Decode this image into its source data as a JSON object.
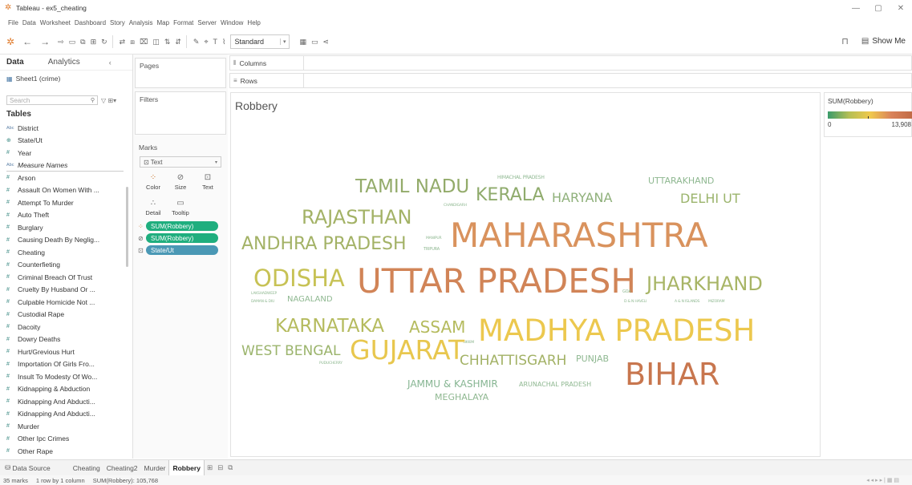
{
  "app": {
    "title": "Tableau - ex5_cheating"
  },
  "menu": [
    "File",
    "Data",
    "Worksheet",
    "Dashboard",
    "Story",
    "Analysis",
    "Map",
    "Format",
    "Server",
    "Window",
    "Help"
  ],
  "toolbar": {
    "fit_select": "Standard",
    "show_me": "Show Me"
  },
  "data_pane": {
    "tab_data": "Data",
    "tab_analytics": "Analytics",
    "source": "Sheet1 (crime)",
    "search_placeholder": "Search",
    "tables_heading": "Tables",
    "fields": [
      {
        "type": "abc",
        "name": "District"
      },
      {
        "type": "geo",
        "name": "State/Ut"
      },
      {
        "type": "num",
        "name": "Year"
      },
      {
        "type": "abc",
        "name": "Measure Names"
      },
      {
        "type": "num",
        "name": "Arson"
      },
      {
        "type": "num",
        "name": "Assault On Women With ..."
      },
      {
        "type": "num",
        "name": "Attempt To Murder"
      },
      {
        "type": "num",
        "name": "Auto Theft"
      },
      {
        "type": "num",
        "name": "Burglary"
      },
      {
        "type": "num",
        "name": "Causing Death By Neglig..."
      },
      {
        "type": "num",
        "name": "Cheating"
      },
      {
        "type": "num",
        "name": "Counterfieting"
      },
      {
        "type": "num",
        "name": "Criminal Breach Of Trust"
      },
      {
        "type": "num",
        "name": "Cruelty By Husband Or ..."
      },
      {
        "type": "num",
        "name": "Culpable Homicide Not ..."
      },
      {
        "type": "num",
        "name": "Custodial Rape"
      },
      {
        "type": "num",
        "name": "Dacoity"
      },
      {
        "type": "num",
        "name": "Dowry Deaths"
      },
      {
        "type": "num",
        "name": "Hurt/Grevious Hurt"
      },
      {
        "type": "num",
        "name": "Importation Of Girls Fro..."
      },
      {
        "type": "num",
        "name": "Insult To Modesty Of Wo..."
      },
      {
        "type": "num",
        "name": "Kidnapping & Abduction"
      },
      {
        "type": "num",
        "name": "Kidnapping And Abducti..."
      },
      {
        "type": "num",
        "name": "Kidnapping And Abducti..."
      },
      {
        "type": "num",
        "name": "Murder"
      },
      {
        "type": "num",
        "name": "Other Ipc Crimes"
      },
      {
        "type": "num",
        "name": "Other Rape"
      }
    ]
  },
  "cards": {
    "pages": "Pages",
    "filters": "Filters",
    "marks": "Marks",
    "mark_type": "Text",
    "buttons": {
      "color": "Color",
      "size": "Size",
      "text": "Text",
      "detail": "Detail",
      "tooltip": "Tooltip"
    },
    "pills": [
      "SUM(Robbery)",
      "SUM(Robbery)",
      "State/Ut"
    ]
  },
  "shelves": {
    "columns": "Columns",
    "rows": "Rows"
  },
  "view": {
    "title": "Robbery",
    "words": [
      {
        "text": "TAMIL NADU",
        "size": 23,
        "color": "#93ab6a"
      },
      {
        "text": "KERALA",
        "size": 22,
        "color": "#8fab6c"
      },
      {
        "text": "HARYANA",
        "size": 16,
        "color": "#8fb07a"
      },
      {
        "text": "UTTARAKHAND",
        "size": 11,
        "color": "#8fb891"
      },
      {
        "text": "DELHI UT",
        "size": 16,
        "color": "#9bb46c"
      },
      {
        "text": "HIMACHAL PRADESH",
        "size": 6,
        "color": "#8fb891"
      },
      {
        "text": "CHANDIGARH",
        "size": 4.5,
        "color": "#8fb891"
      },
      {
        "text": "RAJASTHAN",
        "size": 24,
        "color": "#a3b266"
      },
      {
        "text": "ANDHRA PRADESH",
        "size": 22,
        "color": "#a3b266"
      },
      {
        "text": "MANIPUR",
        "size": 4.5,
        "color": "#8fb891"
      },
      {
        "text": "TRIPURA",
        "size": 5,
        "color": "#8fb891"
      },
      {
        "text": "MAHARASHTRA",
        "size": 42,
        "color": "#d9925d"
      },
      {
        "text": "ODISHA",
        "size": 29,
        "color": "#c7c255"
      },
      {
        "text": "UTTAR PRADESH",
        "size": 42,
        "color": "#d18457"
      },
      {
        "text": "GOA",
        "size": 5,
        "color": "#8fb891"
      },
      {
        "text": "JHARKHAND",
        "size": 24,
        "color": "#a8b566"
      },
      {
        "text": "LAKSHADWEEP",
        "size": 4.5,
        "color": "#8fb891"
      },
      {
        "text": "DAMAN & DIU",
        "size": 4.5,
        "color": "#8fb891"
      },
      {
        "text": "NAGALAND",
        "size": 10,
        "color": "#8fb891"
      },
      {
        "text": "D & N HAVELI",
        "size": 4.5,
        "color": "#8fb891"
      },
      {
        "text": "A & N ISLANDS",
        "size": 4.5,
        "color": "#8fb891"
      },
      {
        "text": "MIZORAM",
        "size": 4.5,
        "color": "#8fb891"
      },
      {
        "text": "KARNATAKA",
        "size": 23,
        "color": "#b5bb5e"
      },
      {
        "text": "ASSAM",
        "size": 20,
        "color": "#b5bb5e"
      },
      {
        "text": "MADHYA PRADESH",
        "size": 37,
        "color": "#ecc84e"
      },
      {
        "text": "SIKKIM",
        "size": 4.5,
        "color": "#8fb891"
      },
      {
        "text": "WEST BENGAL",
        "size": 17,
        "color": "#9bb46c"
      },
      {
        "text": "GUJARAT",
        "size": 33,
        "color": "#e8c74e"
      },
      {
        "text": "PUDUCHERRY",
        "size": 4.5,
        "color": "#8fb891"
      },
      {
        "text": "CHHATTISGARH",
        "size": 17,
        "color": "#a3b266"
      },
      {
        "text": "PUNJAB",
        "size": 11,
        "color": "#8fb891"
      },
      {
        "text": "BIHAR",
        "size": 38,
        "color": "#c8764e"
      },
      {
        "text": "JAMMU & KASHMIR",
        "size": 12,
        "color": "#86b592"
      },
      {
        "text": "ARUNACHAL PRADESH",
        "size": 8,
        "color": "#8fb891"
      },
      {
        "text": "MEGHALAYA",
        "size": 11,
        "color": "#8fb891"
      }
    ]
  },
  "legend": {
    "title": "SUM(Robbery)",
    "min": "0",
    "max": "13,908",
    "colors": [
      "#3a9b6b",
      "#b5bf55",
      "#f0c94d",
      "#d9825a",
      "#c06a45"
    ]
  },
  "sheet_tabs": {
    "data_source": "Data Source",
    "tabs": [
      "Cheating",
      "Cheating2",
      "Murder",
      "Robbery"
    ],
    "active": "Robbery"
  },
  "status": {
    "marks": "35 marks",
    "layout": "1 row by 1 column",
    "sum": "SUM(Robbery): 105,768"
  }
}
